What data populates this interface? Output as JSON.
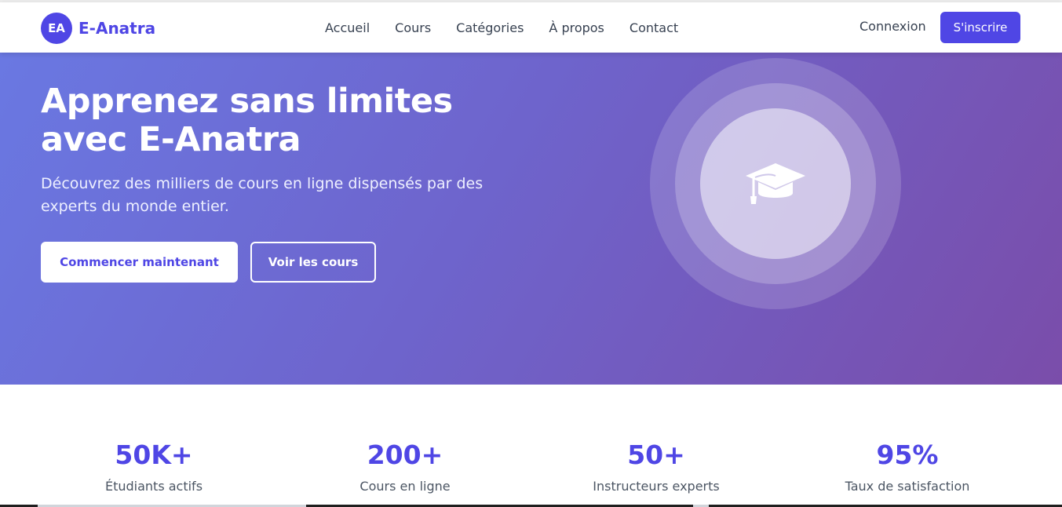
{
  "brand": {
    "badge": "EA",
    "name": "E-Anatra",
    "accent": "#4f46e5"
  },
  "nav": {
    "links": [
      "Accueil",
      "Cours",
      "Catégories",
      "À propos",
      "Contact"
    ],
    "login": "Connexion",
    "signup": "S'inscrire"
  },
  "hero": {
    "title": "Apprenez sans limites avec E-Anatra",
    "subtitle": "Découvrez des milliers de cours en ligne dispensés par des experts du monde entier.",
    "primary_button": "Commencer maintenant",
    "secondary_button": "Voir les cours",
    "illustration_icon": "graduation-cap-icon",
    "gradient": [
      "#6a78e2",
      "#7a4daa"
    ]
  },
  "stats": [
    {
      "value": "50K+",
      "label": "Étudiants actifs"
    },
    {
      "value": "200+",
      "label": "Cours en ligne"
    },
    {
      "value": "50+",
      "label": "Instructeurs experts"
    },
    {
      "value": "95%",
      "label": "Taux de satisfaction"
    }
  ]
}
